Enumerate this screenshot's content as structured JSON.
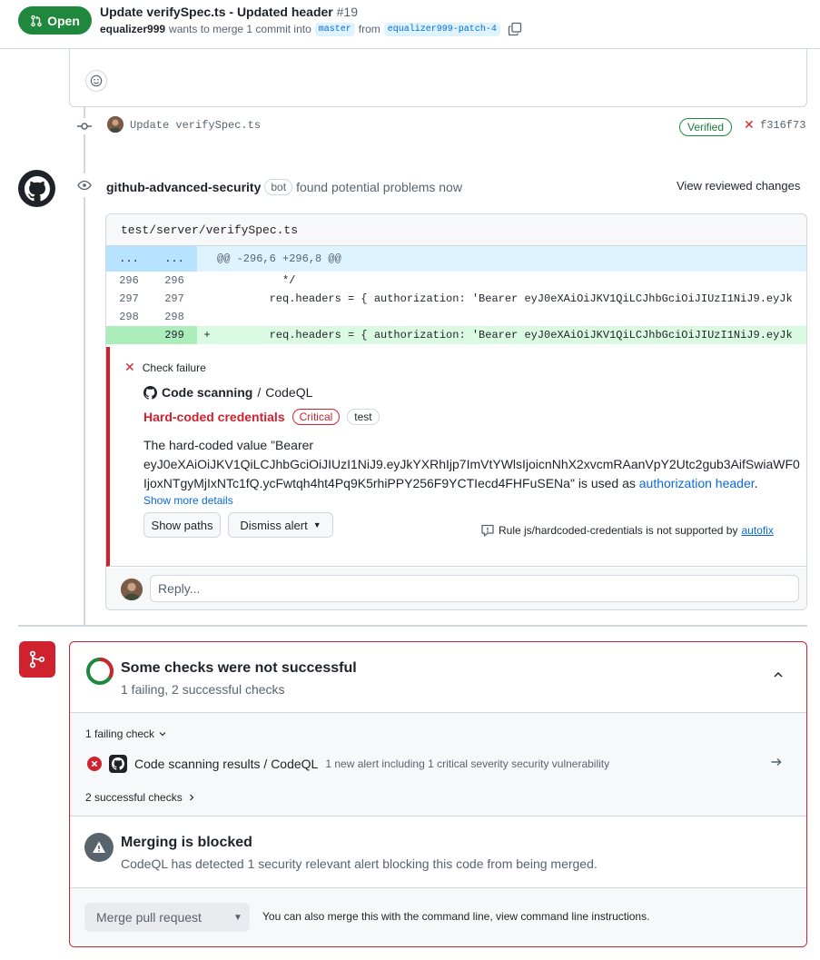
{
  "header": {
    "state": "Open",
    "title": "Update verifySpec.ts - Updated header",
    "number": "#19",
    "author": "equalizer999",
    "merge_text": "wants to merge 1 commit into",
    "base_branch": "master",
    "from_text": "from",
    "head_branch": "equalizer999-patch-4"
  },
  "commit": {
    "message": "Update verifySpec.ts",
    "verified": "Verified",
    "sha": "f316f73"
  },
  "review": {
    "actor": "github-advanced-security",
    "bot_label": "bot",
    "action_text": "found potential problems now",
    "view_reviewed": "View reviewed changes",
    "file_path": "test/server/verifySpec.ts",
    "hunk": {
      "left": "...",
      "right": "...",
      "text": "@@ -296,6 +296,8 @@"
    },
    "lines": [
      {
        "old": "296",
        "new": "296",
        "sign": "",
        "code": "          */"
      },
      {
        "old": "297",
        "new": "297",
        "sign": "",
        "code": "        req.headers = { authorization: 'Bearer eyJ0eXAiOiJKV1QiLCJhbGciOiJIUzI1NiJ9.eyJk"
      },
      {
        "old": "298",
        "new": "298",
        "sign": "",
        "code": ""
      },
      {
        "old": "",
        "new": "299",
        "sign": "+",
        "code": "        req.headers = { authorization: 'Bearer eyJ0eXAiOiJKV1QiLCJhbGciOiJIUzI1NiJ9.eyJk"
      }
    ],
    "alert": {
      "status": "Check failure",
      "tool_name": "Code scanning",
      "tool_sep": "/",
      "tool_sub": "CodeQL",
      "title": "Hard-coded credentials",
      "severity": "Critical",
      "tag": "test",
      "desc_line1": "The hard-coded value \"Bearer",
      "desc_line2": "eyJ0eXAiOiJKV1QiLCJhbGciOiJIUzI1NiJ9.eyJkYXRhIjp7ImVtYWlsIjoicnNhX2xvcmRAanVpY2Utc2gub3AifSwiaWF0",
      "desc_line3": "IjoxNTgyMjIxNTc1fQ.ycFwtqh4ht4Pq9K5rhiPPY256F9YCTIecd4FHFuSENa\" is used as",
      "desc_link": "authorization header",
      "desc_end": ".",
      "show_more": "Show more details",
      "show_paths": "Show paths",
      "dismiss": "Dismiss alert",
      "autofix_text": "Rule js/hardcoded-credentials is not supported by",
      "autofix_link": "autofix"
    },
    "reply_placeholder": "Reply..."
  },
  "merge": {
    "checks_title": "Some checks were not successful",
    "checks_summary": "1 failing, 2 successful checks",
    "failing_toggle": "1 failing check",
    "failing_check": {
      "name": "Code scanning results / CodeQL",
      "description": "1 new alert including 1 critical severity security vulnerability"
    },
    "successful_toggle": "2 successful checks",
    "blocked_title": "Merging is blocked",
    "blocked_desc": "CodeQL has detected 1 security relevant alert blocking this code from being merged.",
    "merge_button": "Merge pull request",
    "merge_note": "You can also merge this with the command line, view command line instructions."
  },
  "colors": {
    "open_green": "#1f883d",
    "danger_red": "#cf222e",
    "link_blue": "#0969da"
  }
}
